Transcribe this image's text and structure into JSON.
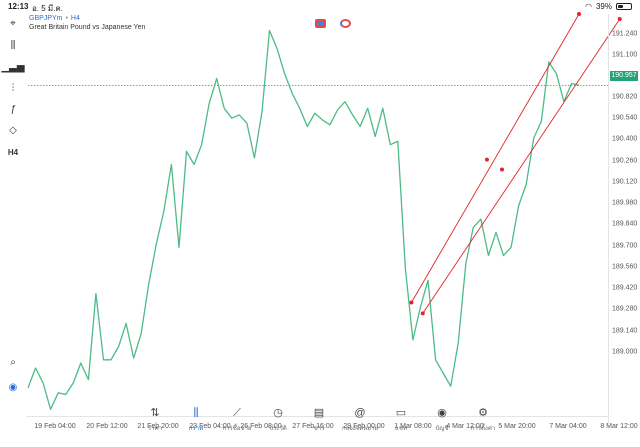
{
  "status": {
    "time": "12:13",
    "date": "อ. 5 มี.ค.",
    "battery": "39%",
    "battery_level": 0.39
  },
  "header": {
    "symbol": "GBPJPYm",
    "timeframe": "H4",
    "description": "Great Britain Pound vs Japanese Yen"
  },
  "toolbar": {
    "icons": [
      "crosshair-icon",
      "candles-icon",
      "indicators-icon",
      "settings-sliders-icon",
      "function-icon",
      "shapes-icon"
    ],
    "timeframe_label": "H4"
  },
  "chart_data": {
    "type": "line",
    "title": "GBPJPYm, H4",
    "color": "#4dbb86",
    "current_price": "190.957",
    "y_ticks": [
      "191.240",
      "191.100",
      "190.957",
      "190.820",
      "190.540",
      "190.400",
      "190.260",
      "190.120",
      "189.980",
      "189.840",
      "189.700",
      "189.560",
      "189.420",
      "189.280",
      "189.140",
      "189.000"
    ],
    "x_ticks": [
      "19 Feb 04:00",
      "20 Feb 12:00",
      "21 Feb 20:00",
      "23 Feb 04:00",
      "26 Feb 08:00",
      "27 Feb 16:00",
      "29 Feb 00:00",
      "1 Mar 08:00",
      "4 Mar 12:00",
      "5 Mar 20:00",
      "7 Mar 04:00",
      "8 Mar 12:00"
    ],
    "ylim": [
      188.96,
      191.39
    ],
    "values": [
      189.13,
      189.25,
      189.16,
      189.0,
      189.1,
      189.09,
      189.16,
      189.28,
      189.18,
      189.7,
      189.3,
      189.3,
      189.38,
      189.52,
      189.31,
      189.46,
      189.76,
      190.0,
      190.2,
      190.48,
      189.98,
      190.56,
      190.48,
      190.6,
      190.85,
      191.0,
      190.82,
      190.76,
      190.78,
      190.73,
      190.52,
      190.8,
      191.29,
      191.18,
      191.03,
      190.91,
      190.82,
      190.71,
      190.79,
      190.75,
      190.72,
      190.81,
      190.86,
      190.78,
      190.71,
      190.82,
      190.65,
      190.82,
      190.6,
      190.62,
      189.85,
      189.42,
      189.62,
      189.78,
      189.3,
      189.22,
      189.14,
      189.4,
      189.88,
      190.1,
      190.15,
      189.93,
      190.07,
      189.93,
      189.98,
      190.23,
      190.36,
      190.64,
      190.74,
      191.1,
      191.03,
      190.86,
      190.97,
      190.96
    ],
    "channel": {
      "color": "#e0262a",
      "upper": {
        "from": {
          "index": 50.8,
          "price": 189.646
        },
        "to": {
          "index": 73.0,
          "price": 191.39
        }
      },
      "lower": {
        "from": {
          "index": 52.3,
          "price": 189.58
        },
        "to": {
          "index": 78.4,
          "price": 191.36
        }
      },
      "mid_anchors": [
        {
          "index": 60.8,
          "price": 190.51
        },
        {
          "index": 62.8,
          "price": 190.45
        }
      ]
    }
  },
  "bottom_nav": [
    {
      "label": "ราคา",
      "icon": "quotes-icon"
    },
    {
      "label": "กราฟ",
      "icon": "chart-icon",
      "active": true
    },
    {
      "label": "การซื้อขาย",
      "icon": "trade-icon"
    },
    {
      "label": "ประวัติ",
      "icon": "history-icon"
    },
    {
      "label": "ข่าว",
      "icon": "news-icon"
    },
    {
      "label": "กล่องจดหมาย",
      "icon": "mailbox-icon"
    },
    {
      "label": "แชท",
      "icon": "chat-icon"
    },
    {
      "label": "บัญชี",
      "icon": "account-icon"
    },
    {
      "label": "การตั้งค่า",
      "icon": "settings-icon"
    }
  ]
}
